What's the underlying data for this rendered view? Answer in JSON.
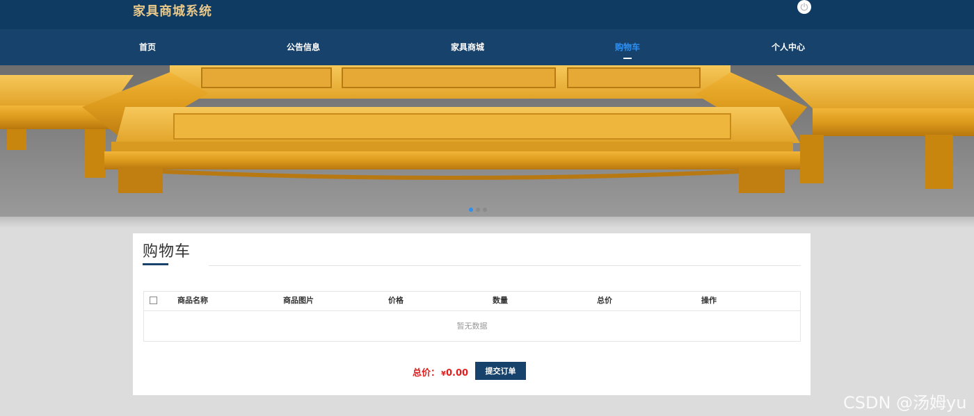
{
  "header": {
    "title": "家具商城系统"
  },
  "nav": {
    "items": [
      {
        "label": "首页"
      },
      {
        "label": "公告信息"
      },
      {
        "label": "家具商城"
      },
      {
        "label": "购物车"
      },
      {
        "label": "个人中心"
      }
    ],
    "active": "购物车"
  },
  "banner": {
    "dot_count": 3,
    "active_dot": 1
  },
  "cart": {
    "title": "购物车",
    "columns": [
      "商品名称",
      "商品图片",
      "价格",
      "数量",
      "总价",
      "操作"
    ],
    "empty_text": "暂无数据",
    "total_label": "总价：",
    "currency": "¥",
    "total_value": "0.00",
    "submit_label": "提交订单"
  },
  "watermark": "CSDN @汤姆yu",
  "colors": {
    "topbar": "#0f3a62",
    "nav": "#17426b",
    "active": "#2f8ff0",
    "logo": "#e8c98a",
    "price": "#e02020"
  }
}
